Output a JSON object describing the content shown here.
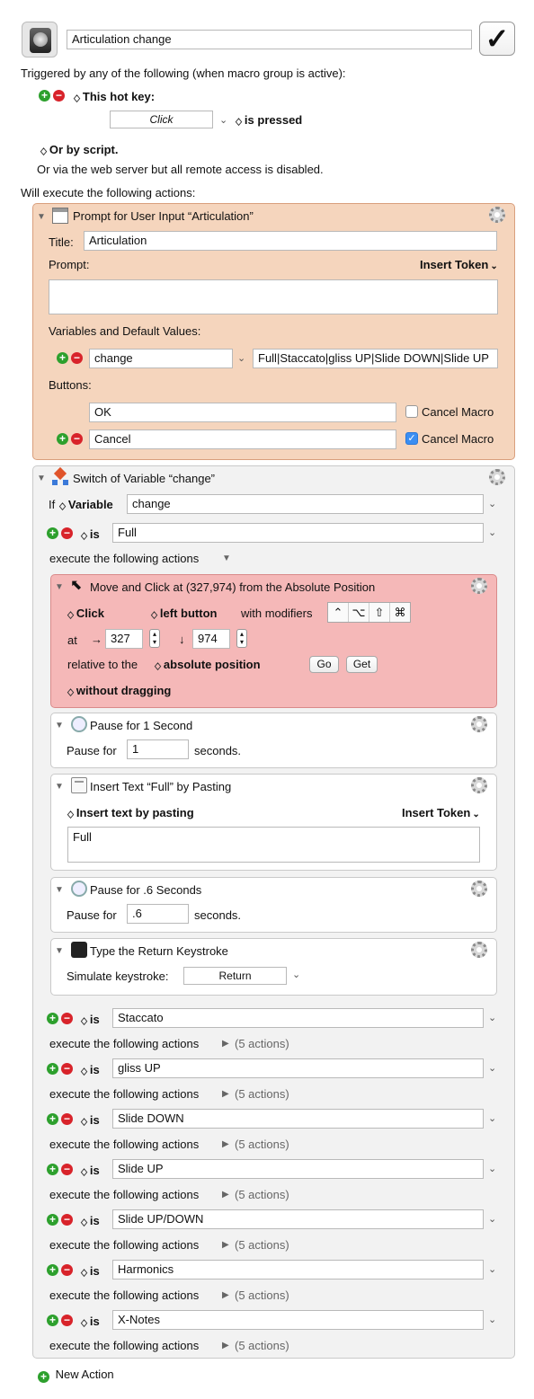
{
  "header": {
    "macro_name": "Articulation change",
    "enabled_check": "✓"
  },
  "trigger": {
    "intro": "Triggered by any of the following (when macro group is active):",
    "hotkey_label": "This hot key:",
    "hotkey_value": "Click",
    "hotkey_state": "is pressed",
    "script_label": "Or by script.",
    "web_note": "Or via the web server but all remote access is disabled."
  },
  "actions_intro": "Will execute the following actions:",
  "prompt": {
    "title": "Prompt for User Input “Articulation”",
    "title_label": "Title:",
    "title_value": "Articulation",
    "prompt_label": "Prompt:",
    "insert_token": "Insert Token",
    "prompt_value": "",
    "vars_label": "Variables and Default Values:",
    "var_name": "change",
    "var_default": "Full|Staccato|gliss UP|Slide DOWN|Slide UP",
    "buttons_label": "Buttons:",
    "buttons": [
      {
        "label": "OK",
        "cancel_label": "Cancel Macro",
        "cancel": false
      },
      {
        "label": "Cancel",
        "cancel_label": "Cancel Macro",
        "cancel": true
      }
    ]
  },
  "switch": {
    "title": "Switch of Variable “change”",
    "if_label": "If",
    "variable_label": "Variable",
    "variable_value": "change",
    "is_label": "is",
    "execute_label": "execute the following actions",
    "first_case": "Full",
    "cases": [
      {
        "value": "Staccato",
        "count": "(5 actions)"
      },
      {
        "value": "gliss UP",
        "count": "(5 actions)"
      },
      {
        "value": "Slide DOWN",
        "count": "(5 actions)"
      },
      {
        "value": "Slide UP",
        "count": "(5 actions)"
      },
      {
        "value": "Slide UP/DOWN",
        "count": "(5 actions)"
      },
      {
        "value": "Harmonics",
        "count": "(5 actions)"
      },
      {
        "value": "X-Notes",
        "count": "(5 actions)"
      }
    ]
  },
  "move_click": {
    "title": "Move and Click at (327,974) from the Absolute Position",
    "click": "Click",
    "button": "left button",
    "with_modifiers": "with modifiers",
    "modifiers": [
      "⌃",
      "⌥",
      "⇧",
      "⌘"
    ],
    "at_label": "at",
    "x": "327",
    "y": "974",
    "relative_label": "relative to the",
    "relative_value": "absolute position",
    "go": "Go",
    "get": "Get",
    "drag": "without dragging",
    "arrow_right": "→",
    "arrow_down": "↓"
  },
  "pause1": {
    "title": "Pause for 1 Second",
    "label": "Pause for",
    "value": "1",
    "unit": "seconds."
  },
  "insert_text": {
    "title": "Insert Text “Full” by Pasting",
    "mode": "Insert text by pasting",
    "insert_token": "Insert Token",
    "text": "Full"
  },
  "pause2": {
    "title": "Pause for .6 Seconds",
    "label": "Pause for",
    "value": ".6",
    "unit": "seconds."
  },
  "keystroke": {
    "title": "Type the Return Keystroke",
    "label": "Simulate keystroke:",
    "value": "Return"
  },
  "footer": {
    "new_action": "New Action"
  },
  "colors": {
    "prompt_bg": "#f5d5bd",
    "prompt_border": "#d99f7d",
    "click_bg": "#f5b8b8",
    "click_border": "#d98a8a"
  }
}
